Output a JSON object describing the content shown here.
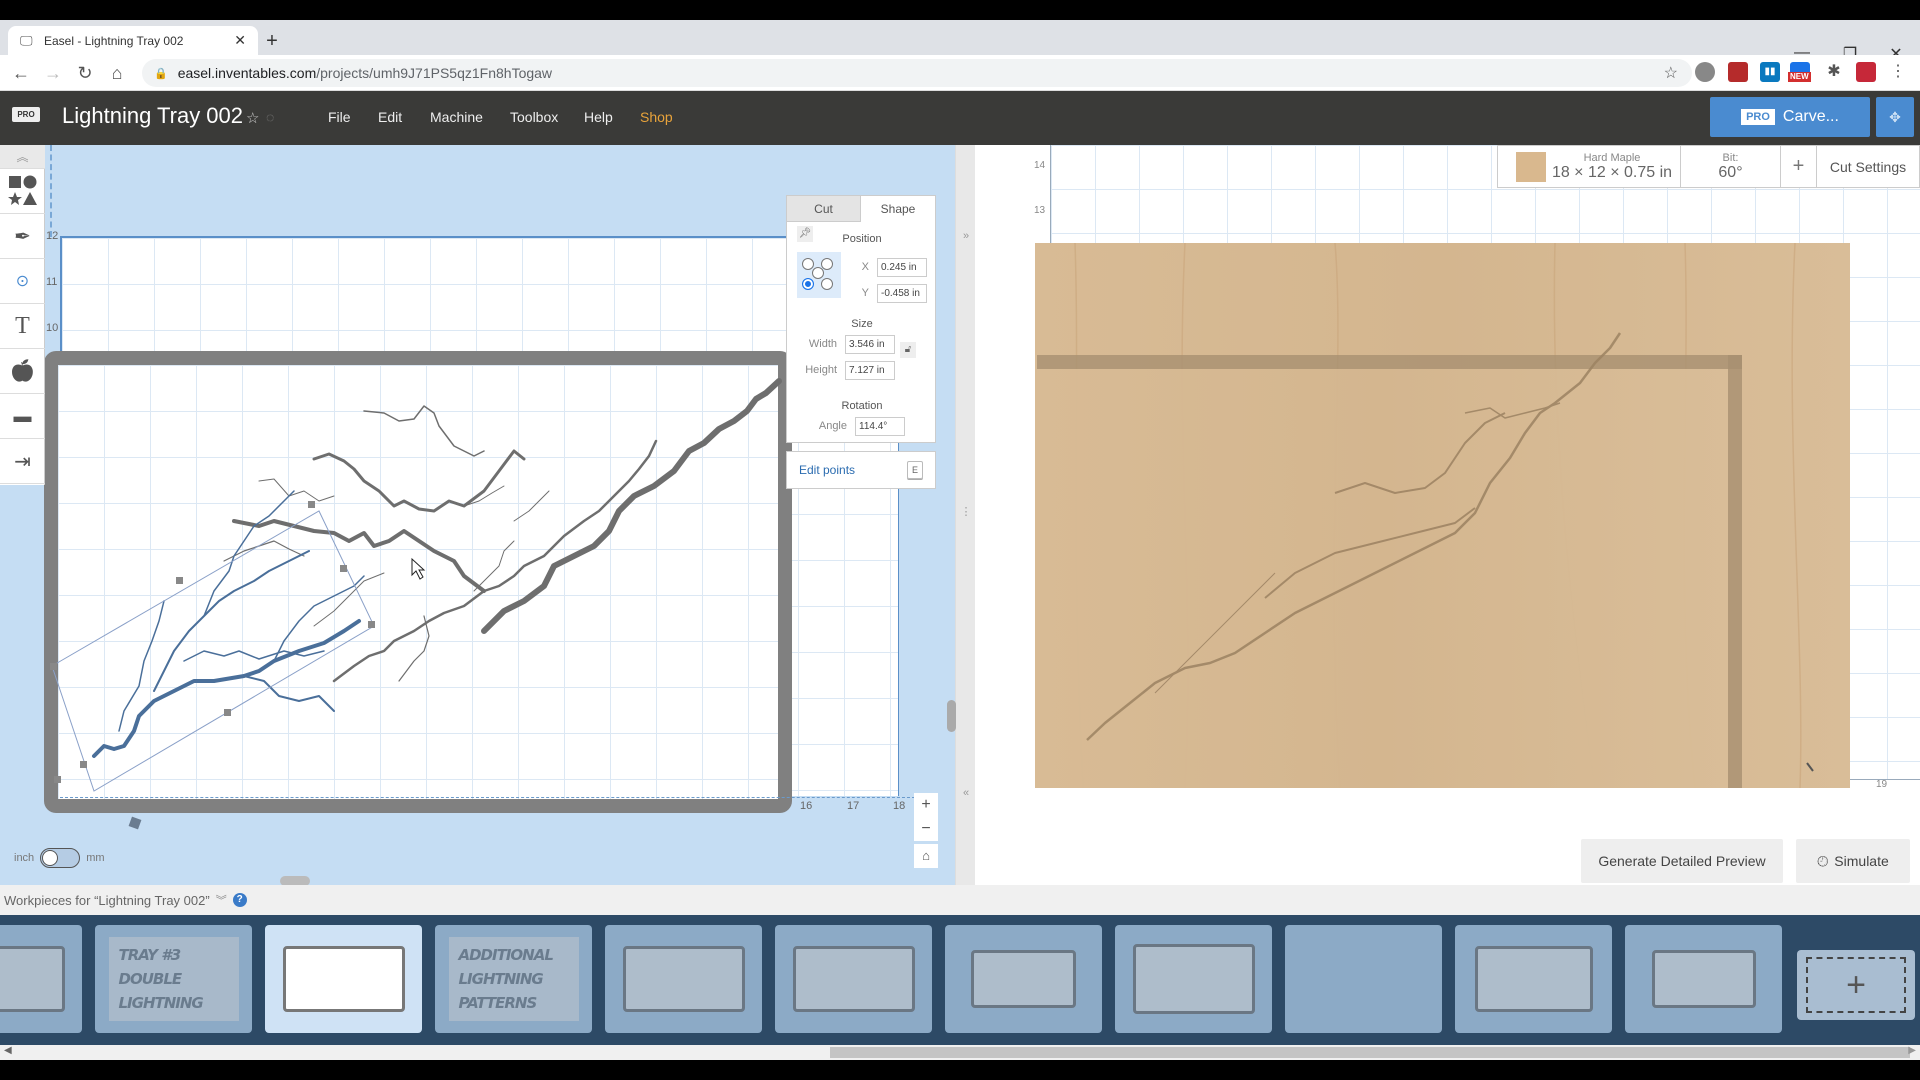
{
  "browser": {
    "tab_title": "Easel - Lightning Tray 002",
    "new_tab": "+",
    "close_tab": "✕",
    "url_domain": "easel.inventables.com",
    "url_path": "/projects/umh9J71PS5qz1Fn8hTogaw",
    "window_controls": [
      "—",
      "❐",
      "✕"
    ],
    "extension_badge": "NEW"
  },
  "app": {
    "logo_badge": "PRO",
    "project_title": "Lightning Tray 002",
    "menu": [
      "File",
      "Edit",
      "Machine",
      "Toolbox",
      "Help",
      "Shop"
    ],
    "carve_badge": "PRO",
    "carve_label": "Carve...",
    "accent_color": "#4a8bd0",
    "shop_color": "#e8a33b"
  },
  "toolbar": {
    "tools": [
      "shapes",
      "pen",
      "point",
      "text",
      "apps",
      "components",
      "import"
    ]
  },
  "canvas": {
    "ruler_left": [
      "12",
      "11",
      "10"
    ],
    "ruler_bottom": [
      "16",
      "17",
      "18"
    ],
    "unit_left": "inch",
    "unit_right": "mm"
  },
  "shape_panel": {
    "tabs": [
      "Cut",
      "Shape"
    ],
    "active_tab": "Shape",
    "position_label": "Position",
    "x_label": "X",
    "x_value": "0.245 in",
    "y_label": "Y",
    "y_value": "-0.458 in",
    "size_label": "Size",
    "width_label": "Width",
    "width_value": "3.546 in",
    "height_label": "Height",
    "height_value": "7.127 in",
    "rotation_label": "Rotation",
    "angle_label": "Angle",
    "angle_value": "114.4°",
    "edit_points_label": "Edit points",
    "edit_points_key": "E"
  },
  "preview": {
    "material_name": "Hard Maple",
    "material_size": "18 × 12 × 0.75 in",
    "material_color": "#d9b88e",
    "bit_label": "Bit:",
    "bit_value": "60°",
    "add_label": "+",
    "cut_settings_label": "Cut Settings",
    "ruler_left": [
      "14",
      "13"
    ],
    "ruler_bottom_last": "19",
    "generate_label": "Generate Detailed Preview",
    "simulate_label": "Simulate"
  },
  "workpieces": {
    "label": "Workpieces for “Lightning Tray 002”",
    "items": [
      {
        "type": "frame",
        "active": false
      },
      {
        "type": "text",
        "text": [
          "TRAY #3",
          "DOUBLE LIGHTNING"
        ],
        "active": false
      },
      {
        "type": "frame",
        "active": true
      },
      {
        "type": "text",
        "text": [
          "ADDITIONAL",
          "LIGHTNING",
          "PATTERNS"
        ],
        "active": false
      },
      {
        "type": "frame",
        "active": false
      },
      {
        "type": "frame",
        "active": false
      },
      {
        "type": "frame",
        "active": false
      },
      {
        "type": "frame",
        "active": false
      },
      {
        "type": "empty",
        "active": false
      },
      {
        "type": "frame",
        "active": false
      },
      {
        "type": "frame",
        "active": false
      }
    ],
    "add_label": "+"
  }
}
